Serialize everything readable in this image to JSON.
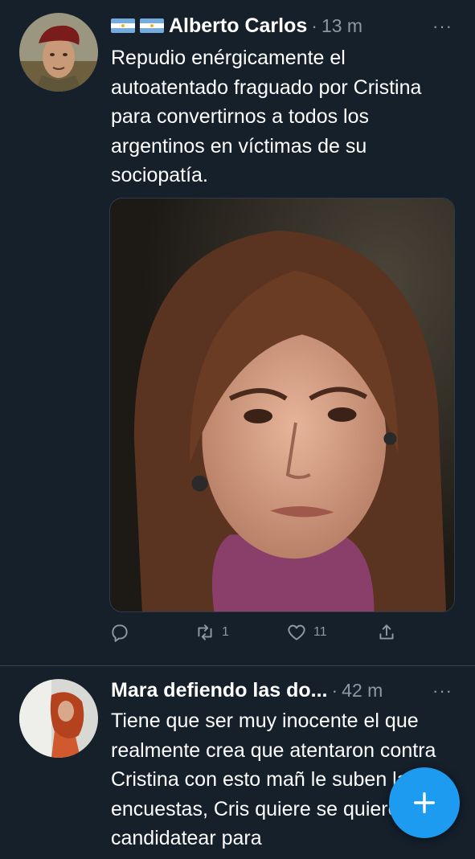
{
  "colors": {
    "background": "#15202b",
    "muted_text": "#8b98a5",
    "accent": "#1d9bf0",
    "divider": "#38444d"
  },
  "tweets": [
    {
      "display_name": "Alberto Carlos",
      "name_prefix_icons": [
        "argentina-flag-icon",
        "argentina-flag-icon"
      ],
      "separator": "·",
      "time": "13 m",
      "more_label": "···",
      "text": "Repudio enérgicamente el autoatentado fraguado por Cristina para convertirnos a todos los argentinos en víctimas de su sociopatía.",
      "has_media": true,
      "actions": {
        "reply": {
          "icon": "reply-icon",
          "count": ""
        },
        "retweet": {
          "icon": "retweet-icon",
          "count": "1"
        },
        "like": {
          "icon": "heart-icon",
          "count": "11"
        },
        "share": {
          "icon": "share-icon",
          "count": ""
        }
      }
    },
    {
      "display_name": "Mara defiendo las do...",
      "separator": "·",
      "time": "42 m",
      "more_label": "···",
      "text": "Tiene que ser muy inocente el que realmente crea que atentaron contra Cristina con esto mañ le suben las encuestas, Cris quiere se quiere  candidatear para"
    }
  ],
  "compose_button": {
    "icon": "plus-icon"
  }
}
